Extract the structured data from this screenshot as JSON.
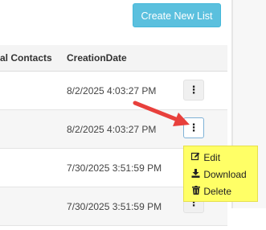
{
  "header": {
    "create_button_label": "Create New List"
  },
  "table": {
    "headers": {
      "contacts": "al Contacts",
      "creation_date": "CreationDate"
    },
    "rows": [
      {
        "creation_date": "8/2/2025 4:03:27 PM"
      },
      {
        "creation_date": "8/2/2025 4:03:27 PM"
      },
      {
        "creation_date": "7/30/2025 3:51:59 PM"
      },
      {
        "creation_date": "7/30/2025 3:51:59 PM"
      }
    ],
    "row_action_glyph": "⋮"
  },
  "actions_menu": {
    "items": [
      {
        "label": "Edit",
        "icon": "edit-icon"
      },
      {
        "label": "Download",
        "icon": "download-icon"
      },
      {
        "label": "Delete",
        "icon": "trash-icon"
      }
    ],
    "highlight_color": "#ffff66"
  },
  "annotation": {
    "arrow_color": "#e8403c",
    "icon": "red-arrow-icon"
  },
  "colors": {
    "accent": "#5bc0de"
  }
}
